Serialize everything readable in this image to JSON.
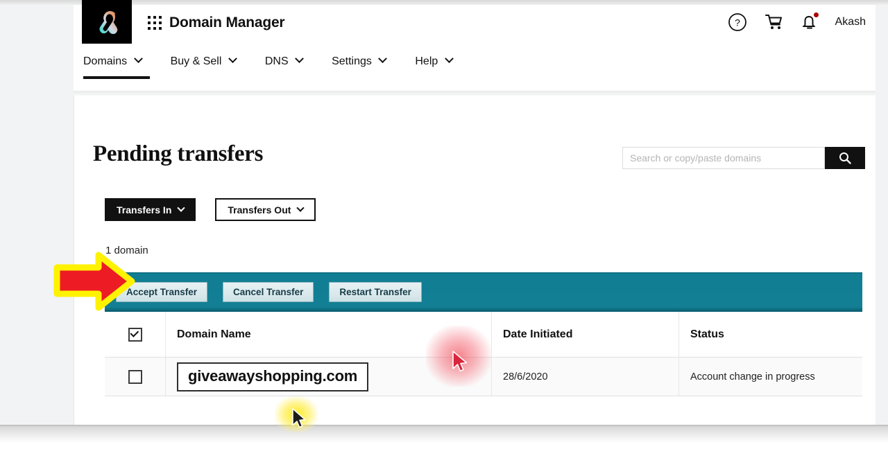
{
  "header": {
    "logo_icon": "godaddy-logo-icon",
    "waffle_icon": "app-grid-icon",
    "app_title": "Domain Manager",
    "help_icon": "help-circle-icon",
    "cart_icon": "shopping-cart-icon",
    "bell_icon": "notification-bell-icon",
    "user_name": "Akash"
  },
  "nav": {
    "items": [
      {
        "label": "Domains",
        "active": true
      },
      {
        "label": "Buy & Sell",
        "active": false
      },
      {
        "label": "DNS",
        "active": false
      },
      {
        "label": "Settings",
        "active": false
      },
      {
        "label": "Help",
        "active": false
      }
    ]
  },
  "main": {
    "page_title": "Pending transfers",
    "search": {
      "placeholder": "Search or copy/paste domains",
      "value": "",
      "button_icon": "search-icon"
    },
    "filters": [
      {
        "label": "Transfers In",
        "style": "dark"
      },
      {
        "label": "Transfers Out",
        "style": "light"
      }
    ],
    "domain_count": "1 domain",
    "actions": [
      {
        "label": "Accept Transfer"
      },
      {
        "label": "Cancel Transfer"
      },
      {
        "label": "Restart Transfer"
      }
    ],
    "table": {
      "columns": [
        "Domain Name",
        "Date Initiated",
        "Status"
      ],
      "header_checkbox_checked": true,
      "rows": [
        {
          "checked": false,
          "domain": "giveawayshopping.com",
          "date_initiated": "28/6/2020",
          "status": "Account change in progress"
        }
      ]
    }
  },
  "annotations": {
    "arrow_icon": "red-right-arrow-annotation",
    "arrow_fill": "#ED1C24",
    "arrow_stroke": "#FFF200",
    "red_cursor_icon": "mouse-pointer-icon",
    "yellow_cursor_icon": "mouse-pointer-icon",
    "click_highlight_red": "#F03746",
    "click_highlight_yellow": "#FFE800"
  },
  "theme": {
    "accent_teal": "#137F95",
    "dark": "#111111",
    "card_bg": "#FFFFFF",
    "page_bg": "#F2F3F4"
  }
}
